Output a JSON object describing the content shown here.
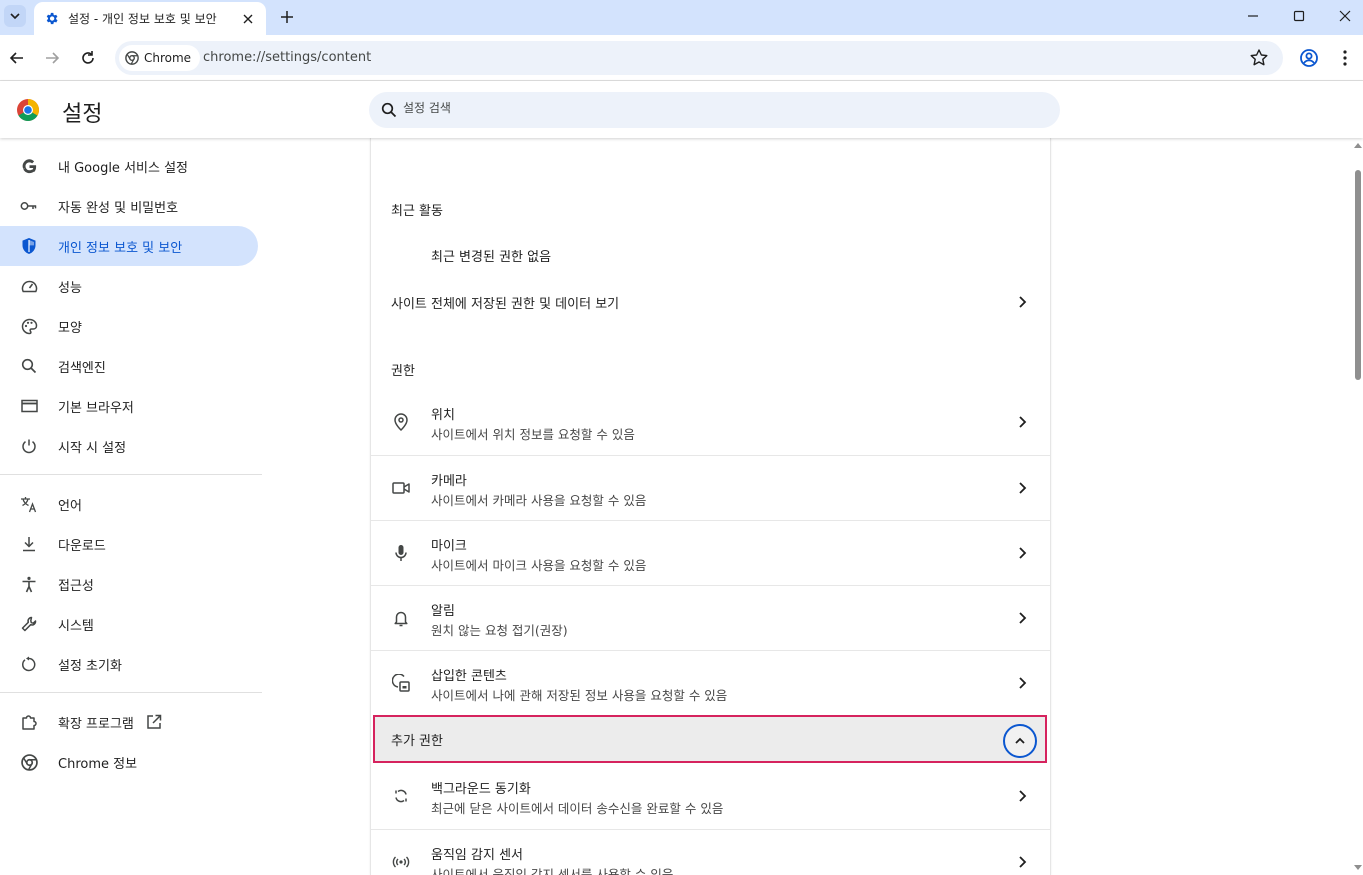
{
  "browser": {
    "tab_title": "설정 - 개인 정보 보호 및 보안",
    "chip_label": "Chrome",
    "url": "chrome://settings/content"
  },
  "header": {
    "title": "설정",
    "search_placeholder": "설정 검색"
  },
  "sidebar": {
    "items": [
      {
        "label": "내 Google 서비스 설정",
        "icon": "google-g-icon"
      },
      {
        "label": "자동 완성 및 비밀번호",
        "icon": "key-icon"
      },
      {
        "label": "개인 정보 보호 및 보안",
        "icon": "shield-icon",
        "active": true
      },
      {
        "label": "성능",
        "icon": "speedometer-icon"
      },
      {
        "label": "모양",
        "icon": "palette-icon"
      },
      {
        "label": "검색엔진",
        "icon": "search-icon"
      },
      {
        "label": "기본 브라우저",
        "icon": "browser-window-icon"
      },
      {
        "label": "시작 시 설정",
        "icon": "power-icon"
      },
      {
        "label": "언어",
        "icon": "translate-icon"
      },
      {
        "label": "다운로드",
        "icon": "download-icon"
      },
      {
        "label": "접근성",
        "icon": "accessibility-icon"
      },
      {
        "label": "시스템",
        "icon": "wrench-icon"
      },
      {
        "label": "설정 초기화",
        "icon": "reset-icon"
      },
      {
        "label": "확장 프로그램",
        "icon": "extension-icon"
      },
      {
        "label": "Chrome 정보",
        "icon": "chrome-icon"
      }
    ]
  },
  "content": {
    "recent_title": "최근 활동",
    "recent_empty": "최근 변경된 권한 없음",
    "view_all_label": "사이트 전체에 저장된 권한 및 데이터 보기",
    "permissions_title": "권한",
    "permissions": [
      {
        "title": "위치",
        "subtitle": "사이트에서 위치 정보를 요청할 수 있음",
        "icon": "location-pin-icon"
      },
      {
        "title": "카메라",
        "subtitle": "사이트에서 카메라 사용을 요청할 수 있음",
        "icon": "camera-icon"
      },
      {
        "title": "마이크",
        "subtitle": "사이트에서 마이크 사용을 요청할 수 있음",
        "icon": "microphone-icon"
      },
      {
        "title": "알림",
        "subtitle": "원치 않는 요청 접기(권장)",
        "icon": "bell-icon"
      },
      {
        "title": "삽입한 콘텐츠",
        "subtitle": "사이트에서 나에 관해 저장된 정보 사용을 요청할 수 있음",
        "icon": "embedded-content-icon"
      }
    ],
    "more_permissions_label": "추가 권한",
    "more_permissions": [
      {
        "title": "백그라운드 동기화",
        "subtitle": "최근에 닫은 사이트에서 데이터 송수신을 완료할 수 있음",
        "icon": "sync-icon"
      },
      {
        "title": "움직임 감지 센서",
        "subtitle": "사이트에서 움직임 감지 센서를 사용할 수 있음",
        "icon": "motion-sensor-icon"
      }
    ]
  },
  "colors": {
    "accent": "#0b57d0",
    "active_nav_bg": "#d3e3fd",
    "highlight_border": "#d6235e"
  }
}
